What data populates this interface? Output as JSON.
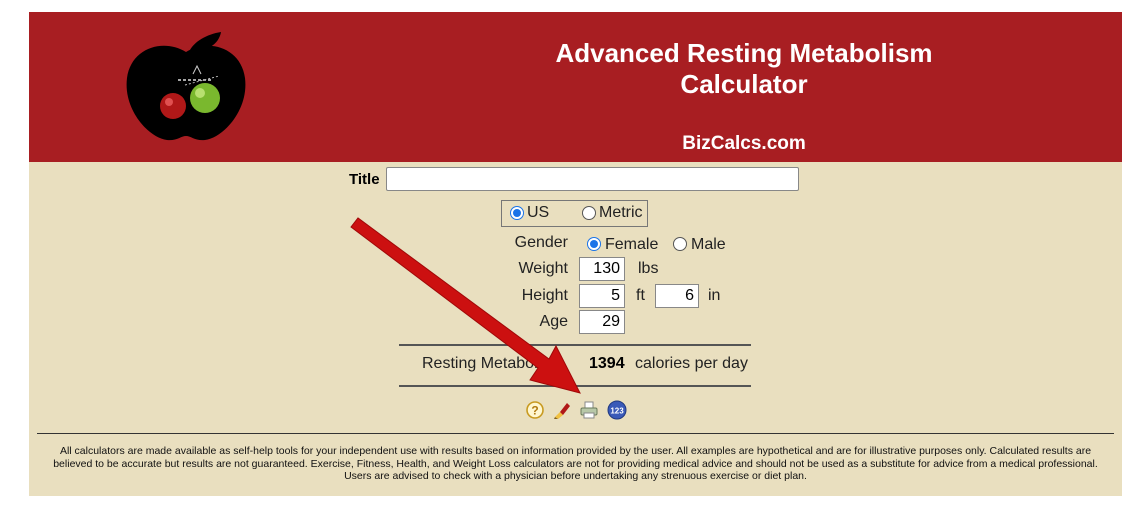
{
  "header": {
    "title_line1": "Advanced Resting Metabolism",
    "title_line2": "Calculator",
    "site_name": "BizCalcs.com"
  },
  "form": {
    "title_label": "Title",
    "title_value": "",
    "units": [
      {
        "label": "US",
        "selected": true
      },
      {
        "label": "Metric",
        "selected": false
      }
    ],
    "gender_label": "Gender",
    "gender_options": [
      {
        "label": "Female",
        "selected": true
      },
      {
        "label": "Male",
        "selected": false
      }
    ],
    "weight_label": "Weight",
    "weight_value": "130",
    "weight_unit": "lbs",
    "height_label": "Height",
    "height_ft_value": "5",
    "height_ft_unit": "ft",
    "height_in_value": "6",
    "height_in_unit": "in",
    "age_label": "Age",
    "age_value": "29"
  },
  "result": {
    "label": "Resting Metabolism",
    "value": "1394",
    "unit": "calories per day"
  },
  "icons": [
    "help-icon",
    "clear-icon",
    "print-icon",
    "sequence-icon"
  ],
  "disclaimer": "All calculators are made available as self-help tools for your independent use with results based on information provided by the user. All examples are hypothetical and are for illustrative purposes only. Calculated results are believed to be accurate but results are not guaranteed. Exercise, Fitness, Health, and Weight Loss calculators are not for providing medical advice and should not be used as a substitute for advice from a medical professional. Users are advised to check with a physician before undertaking any strenuous exercise or diet plan."
}
